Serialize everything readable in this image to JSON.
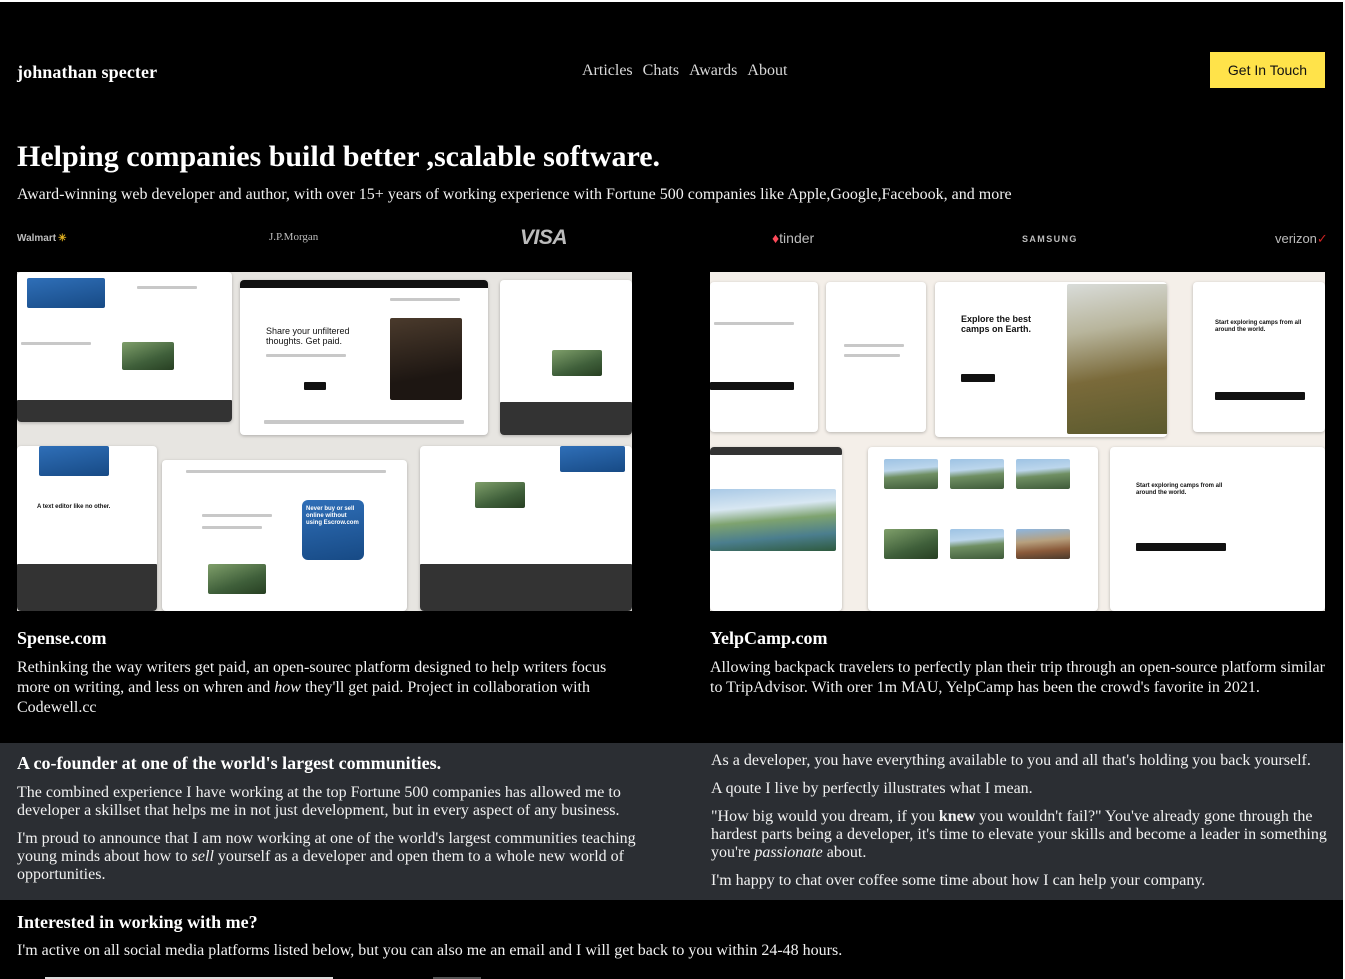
{
  "header": {
    "brand": "johnathan specter",
    "nav": [
      "Articles",
      "Chats",
      "Awards",
      "About"
    ],
    "cta_label": "Get In Touch"
  },
  "hero": {
    "title": "Helping companies build better ,scalable software.",
    "subtitle": "Award-winning web developer and author, with over 15+ years of working experience with Fortune 500 companies like Apple,Google,Facebook, and more"
  },
  "logos": [
    "Walmart",
    "J.P.Morgan",
    "VISA",
    "tinder",
    "SAMSUNG",
    "verizon"
  ],
  "projects": [
    {
      "title": "Spense.com",
      "description_html": "Rethinking the way writers get paid, an open-sourec platform designed to help writers focus more on writing, and less on whren and <em>how</em> they'll get paid. Project in collaboration with Codewell.cc",
      "screenshot_text": [
        "Share your unfiltered thoughts. Get paid.",
        "Never buy or sell online without using Escrow.com",
        "A text editor like no other."
      ]
    },
    {
      "title": "YelpCamp.com",
      "description_html": "Allowing backpack travelers to perfectly plan their trip through an open-source platform similar to TripAdvisor. With orer 1m MAU, YelpCamp has been the crowd's favorite in 2021.",
      "screenshot_text": [
        "Explore the best camps on Earth.",
        "Start exploring camps from all around the world."
      ]
    }
  ],
  "about": {
    "title": "A co-founder at one of the world's largest communities.",
    "paragraphs_html": [
      "The combined experience I have working at the top Fortune 500 companies has allowed me to developer a skillset that helps me in not just development, but in every aspect of any business.",
      "I'm proud to announce that I am now working at one of the world's largest communities teaching young minds about how to <em>sell</em> yourself as a developer and open them to a whole new world of opportunities.",
      "As a developer, you have everything available to you and all that's holding you back yourself.",
      "A qoute I live by perfectly illustrates what I mean.",
      "\"How big would you dream, if you <strong>knew</strong> you wouldn't fail?\" You've already gone through the hardest parts being a developer, it's time to elevate your skills and become a leader in something you're <em>passionate</em> about.",
      "I'm happy to chat over coffee some time about how I can help your company."
    ]
  },
  "contact": {
    "title": "Interested in working with me?",
    "description": "I'm active on all social media platforms listed below, but you can also me an email and I will get back to you within 24-48 hours."
  },
  "colors": {
    "background": "#000000",
    "cta": "#ffe34a",
    "about_band": "#2b2e33"
  }
}
